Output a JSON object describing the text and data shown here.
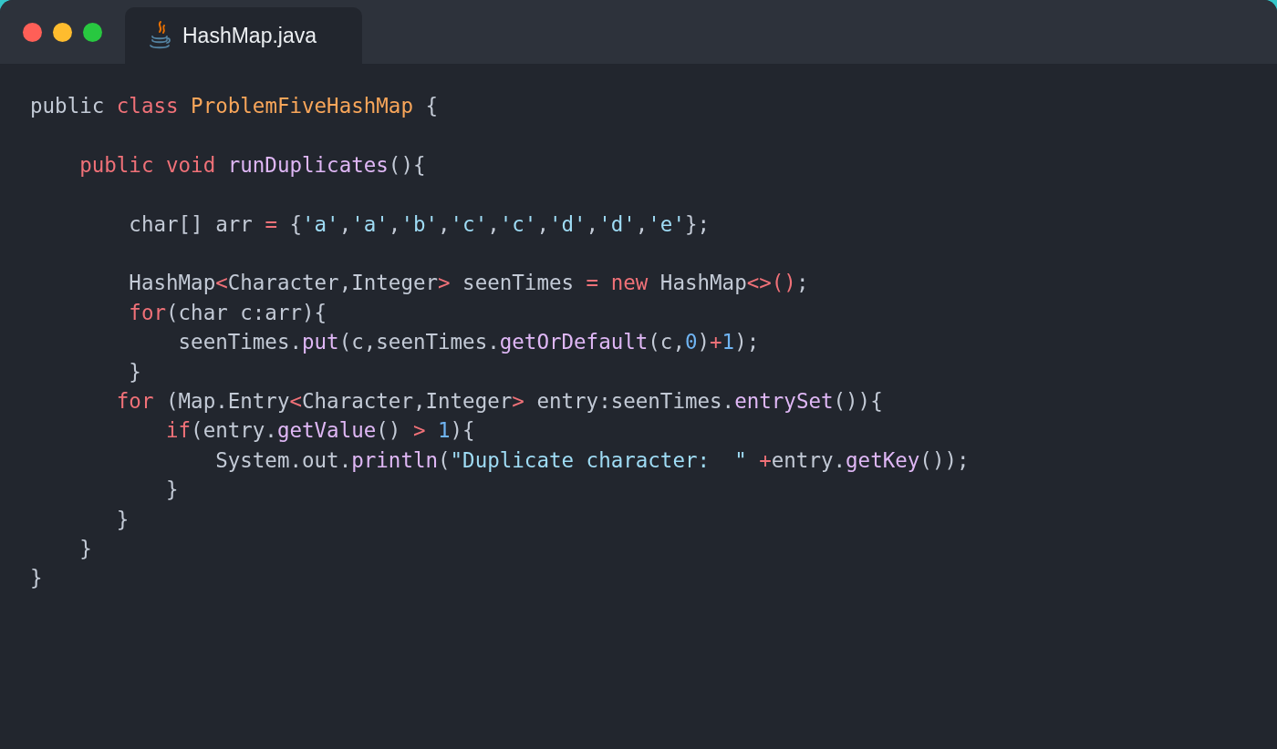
{
  "window": {
    "controls": [
      {
        "color": "#ff5f57"
      },
      {
        "color": "#febc2e"
      },
      {
        "color": "#28c840"
      }
    ]
  },
  "tabs": [
    {
      "label": "HashMap.java",
      "selected": true
    }
  ],
  "code_lines": [
    {
      "kind": "code",
      "tokens": [
        {
          "text": "public",
          "kind": "plain"
        },
        {
          "text": " class ",
          "kind": "keyword"
        },
        {
          "text": "ProblemFiveHashMap",
          "kind": "type"
        },
        {
          "text": " {",
          "kind": "plain"
        }
      ]
    },
    {
      "kind": "blank"
    },
    {
      "kind": "code",
      "tokens": [
        {
          "text": "    public void ",
          "kind": "keyword"
        },
        {
          "text": "runDuplicates",
          "kind": "method"
        },
        {
          "text": "(){",
          "kind": "plain"
        }
      ]
    },
    {
      "kind": "blank"
    },
    {
      "kind": "code",
      "tokens": [
        {
          "text": "        char[] arr ",
          "kind": "plain"
        },
        {
          "text": "=",
          "kind": "operator"
        },
        {
          "text": " {",
          "kind": "plain"
        },
        {
          "text": "'a'",
          "kind": "string"
        },
        {
          "text": ",",
          "kind": "plain"
        },
        {
          "text": "'a'",
          "kind": "string"
        },
        {
          "text": ",",
          "kind": "plain"
        },
        {
          "text": "'b'",
          "kind": "string"
        },
        {
          "text": ",",
          "kind": "plain"
        },
        {
          "text": "'c'",
          "kind": "string"
        },
        {
          "text": ",",
          "kind": "plain"
        },
        {
          "text": "'c'",
          "kind": "string"
        },
        {
          "text": ",",
          "kind": "plain"
        },
        {
          "text": "'d'",
          "kind": "string"
        },
        {
          "text": ",",
          "kind": "plain"
        },
        {
          "text": "'d'",
          "kind": "string"
        },
        {
          "text": ",",
          "kind": "plain"
        },
        {
          "text": "'e'",
          "kind": "string"
        },
        {
          "text": "};",
          "kind": "plain"
        }
      ]
    },
    {
      "kind": "blank"
    },
    {
      "kind": "code",
      "tokens": [
        {
          "text": "        HashMap",
          "kind": "plain"
        },
        {
          "text": "<",
          "kind": "operator"
        },
        {
          "text": "Character,Integer",
          "kind": "plain"
        },
        {
          "text": ">",
          "kind": "operator"
        },
        {
          "text": " seenTimes ",
          "kind": "plain"
        },
        {
          "text": "=",
          "kind": "operator"
        },
        {
          "text": " new",
          "kind": "keyword"
        },
        {
          "text": " HashMap",
          "kind": "plain"
        },
        {
          "text": "<>()",
          "kind": "operator"
        },
        {
          "text": ";",
          "kind": "plain"
        }
      ]
    },
    {
      "kind": "code",
      "tokens": [
        {
          "text": "        for",
          "kind": "keyword"
        },
        {
          "text": "(char c:arr){",
          "kind": "plain"
        }
      ]
    },
    {
      "kind": "code",
      "tokens": [
        {
          "text": "            seenTimes.",
          "kind": "plain"
        },
        {
          "text": "put",
          "kind": "method"
        },
        {
          "text": "(c,seenTimes.",
          "kind": "plain"
        },
        {
          "text": "getOrDefault",
          "kind": "method"
        },
        {
          "text": "(c,",
          "kind": "plain"
        },
        {
          "text": "0",
          "kind": "number"
        },
        {
          "text": ")",
          "kind": "plain"
        },
        {
          "text": "+",
          "kind": "operator"
        },
        {
          "text": "1",
          "kind": "number"
        },
        {
          "text": ");",
          "kind": "plain"
        }
      ]
    },
    {
      "kind": "code",
      "tokens": [
        {
          "text": "        }",
          "kind": "plain"
        }
      ]
    },
    {
      "kind": "code",
      "tokens": [
        {
          "text": "       for",
          "kind": "keyword"
        },
        {
          "text": " (Map.Entry",
          "kind": "plain"
        },
        {
          "text": "<",
          "kind": "operator"
        },
        {
          "text": "Character,Integer",
          "kind": "plain"
        },
        {
          "text": ">",
          "kind": "operator"
        },
        {
          "text": " entry:seenTimes.",
          "kind": "plain"
        },
        {
          "text": "entrySet",
          "kind": "method"
        },
        {
          "text": "()){",
          "kind": "plain"
        }
      ]
    },
    {
      "kind": "code",
      "tokens": [
        {
          "text": "           if",
          "kind": "keyword"
        },
        {
          "text": "(entry.",
          "kind": "plain"
        },
        {
          "text": "getValue",
          "kind": "method"
        },
        {
          "text": "() ",
          "kind": "plain"
        },
        {
          "text": ">",
          "kind": "operator"
        },
        {
          "text": " 1",
          "kind": "number"
        },
        {
          "text": "){",
          "kind": "plain"
        }
      ]
    },
    {
      "kind": "code",
      "tokens": [
        {
          "text": "               System.out.",
          "kind": "plain"
        },
        {
          "text": "println",
          "kind": "method"
        },
        {
          "text": "(",
          "kind": "plain"
        },
        {
          "text": "\"Duplicate character:  \"",
          "kind": "string"
        },
        {
          "text": " +",
          "kind": "operator"
        },
        {
          "text": "entry.",
          "kind": "plain"
        },
        {
          "text": "getKey",
          "kind": "method"
        },
        {
          "text": "());",
          "kind": "plain"
        }
      ]
    },
    {
      "kind": "code",
      "tokens": [
        {
          "text": "           }",
          "kind": "plain"
        }
      ]
    },
    {
      "kind": "code",
      "tokens": [
        {
          "text": "       }",
          "kind": "plain"
        }
      ]
    },
    {
      "kind": "code",
      "tokens": [
        {
          "text": "    }",
          "kind": "plain"
        }
      ]
    },
    {
      "kind": "code",
      "tokens": [
        {
          "text": "}",
          "kind": "plain"
        }
      ]
    }
  ]
}
